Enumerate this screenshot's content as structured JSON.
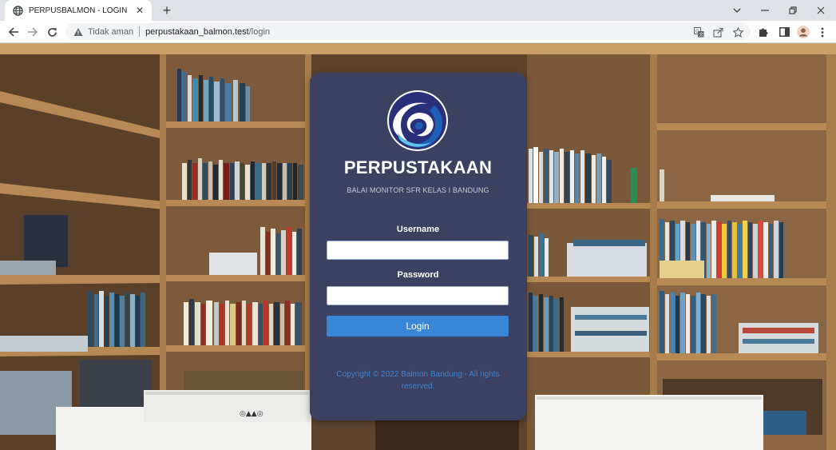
{
  "browser": {
    "tab_title": "PERPUSBALMON - LOGIN",
    "security_label": "Tidak aman",
    "url_host": "perpustakaan_balmon.test",
    "url_path": "/login"
  },
  "login": {
    "brand": "PERPUSTAKAAN",
    "subtitle": "BALAI MONITOR SFR KELAS I BANDUNG",
    "username_label": "Username",
    "username_value": "",
    "password_label": "Password",
    "password_value": "",
    "login_button": "Login",
    "copyright": "Copyright © 2022 Balmon Bandung - All rights reserved."
  },
  "colors": {
    "card_bg": "#3c4061",
    "accent": "#3a86d6",
    "tabbar_bg": "#dee1e6"
  },
  "icons": {
    "tab": "globe-icon",
    "security": "warning-triangle-icon",
    "translate": "translate-icon",
    "share": "share-icon",
    "bookmark": "star-icon",
    "extensions": "puzzle-icon",
    "sidepanel": "side-panel-icon",
    "profile": "avatar-icon",
    "menu": "kebab-menu-icon"
  }
}
